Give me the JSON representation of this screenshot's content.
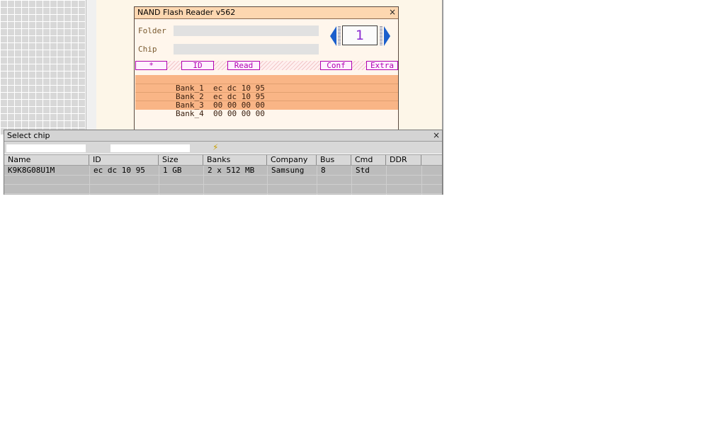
{
  "nand_window": {
    "title": "NAND Flash Reader v562",
    "close": "×",
    "folder_label": "Folder",
    "chip_label": "Chip",
    "counter": "1",
    "buttons": {
      "star": "*",
      "id": "ID",
      "read": "Read",
      "conf": "Conf",
      "extra": "Extra"
    },
    "banks": [
      {
        "name": "Bank_1",
        "id": "ec dc 10 95"
      },
      {
        "name": "Bank_2",
        "id": "ec dc 10 95"
      },
      {
        "name": "Bank_3",
        "id": "00 00 00 00"
      },
      {
        "name": "Bank_4",
        "id": "00 00 00 00"
      }
    ]
  },
  "select_chip": {
    "title": "Select chip",
    "close": "×",
    "filter_icon": "⚡",
    "columns": [
      "Name",
      "ID",
      "Size",
      "Banks",
      "Company",
      "Bus",
      "Cmd",
      "DDR"
    ],
    "rows": [
      {
        "name": "K9K8G08U1M",
        "id": "ec dc 10 95",
        "size": "1 GB",
        "banks": "2 x 512 MB",
        "company": "Samsung",
        "bus": "8",
        "cmd": "Std",
        "ddr": ""
      }
    ]
  },
  "colors": {
    "nand_title_bg": "#fdd7b0",
    "bank_bg": "#f9b586",
    "button_border": "#b000b0",
    "counter_text": "#8a2ad0",
    "arrow": "#1c5fcc"
  }
}
